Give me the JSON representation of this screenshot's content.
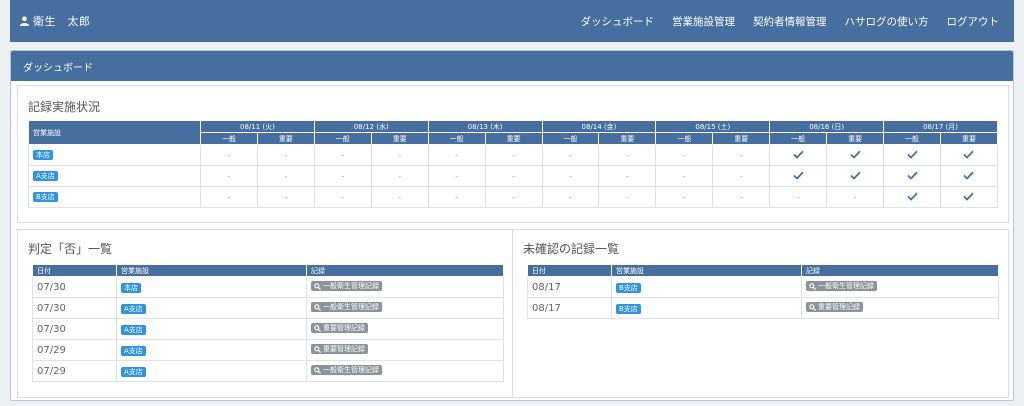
{
  "header": {
    "user_name": "衛生　太郎",
    "nav": [
      "ダッシュボード",
      "営業施設管理",
      "契約者情報管理",
      "ハサログの使い方",
      "ログアウト"
    ]
  },
  "panel": {
    "title": "ダッシュボード"
  },
  "status": {
    "title": "記録実施状況",
    "store_header": "営業施設",
    "dates": [
      "08/11 (火)",
      "08/12 (水)",
      "08/13 (木)",
      "08/14 (金)",
      "08/15 (土)",
      "08/16 (日)",
      "08/17 (月)"
    ],
    "sub_headers": [
      "一般",
      "重要"
    ],
    "rows": [
      {
        "store": "本店",
        "cells": [
          "-",
          "-",
          "-",
          "-",
          "-",
          "-",
          "-",
          "-",
          "-",
          "-",
          "check",
          "check",
          "check",
          "check"
        ]
      },
      {
        "store": "A支店",
        "cells": [
          "-",
          "-",
          "-",
          "-",
          "-",
          "-",
          "-",
          "-",
          "-",
          "-",
          "check",
          "check",
          "check",
          "check"
        ]
      },
      {
        "store": "B支店",
        "cells": [
          "-",
          "-",
          "-",
          "-",
          "-",
          "-",
          "-",
          "-",
          "-",
          "-",
          "-",
          "-",
          "check",
          "check"
        ]
      }
    ]
  },
  "rejected": {
    "title": "判定「否」一覧",
    "headers": [
      "日付",
      "営業施設",
      "記録"
    ],
    "rows": [
      {
        "date": "07/30",
        "store": "本店",
        "record": "一般衛生管理記録"
      },
      {
        "date": "07/30",
        "store": "A支店",
        "record": "一般衛生管理記録"
      },
      {
        "date": "07/30",
        "store": "A支店",
        "record": "重要管理記録"
      },
      {
        "date": "07/29",
        "store": "A支店",
        "record": "重要管理記録"
      },
      {
        "date": "07/29",
        "store": "A支店",
        "record": "一般衛生管理記録"
      }
    ]
  },
  "unconfirmed": {
    "title": "未確認の記録一覧",
    "headers": [
      "日付",
      "営業施設",
      "記録"
    ],
    "rows": [
      {
        "date": "08/17",
        "store": "B支店",
        "record": "一般衛生管理記録"
      },
      {
        "date": "08/17",
        "store": "B支店",
        "record": "重要管理記録"
      }
    ]
  },
  "colors": {
    "primary": "#466f9f",
    "badge": "#2e93e4",
    "record_button": "#8d939a",
    "check": "#466f9f"
  },
  "icons": {
    "user": "user-icon",
    "search": "search-icon",
    "check": "check-icon"
  }
}
